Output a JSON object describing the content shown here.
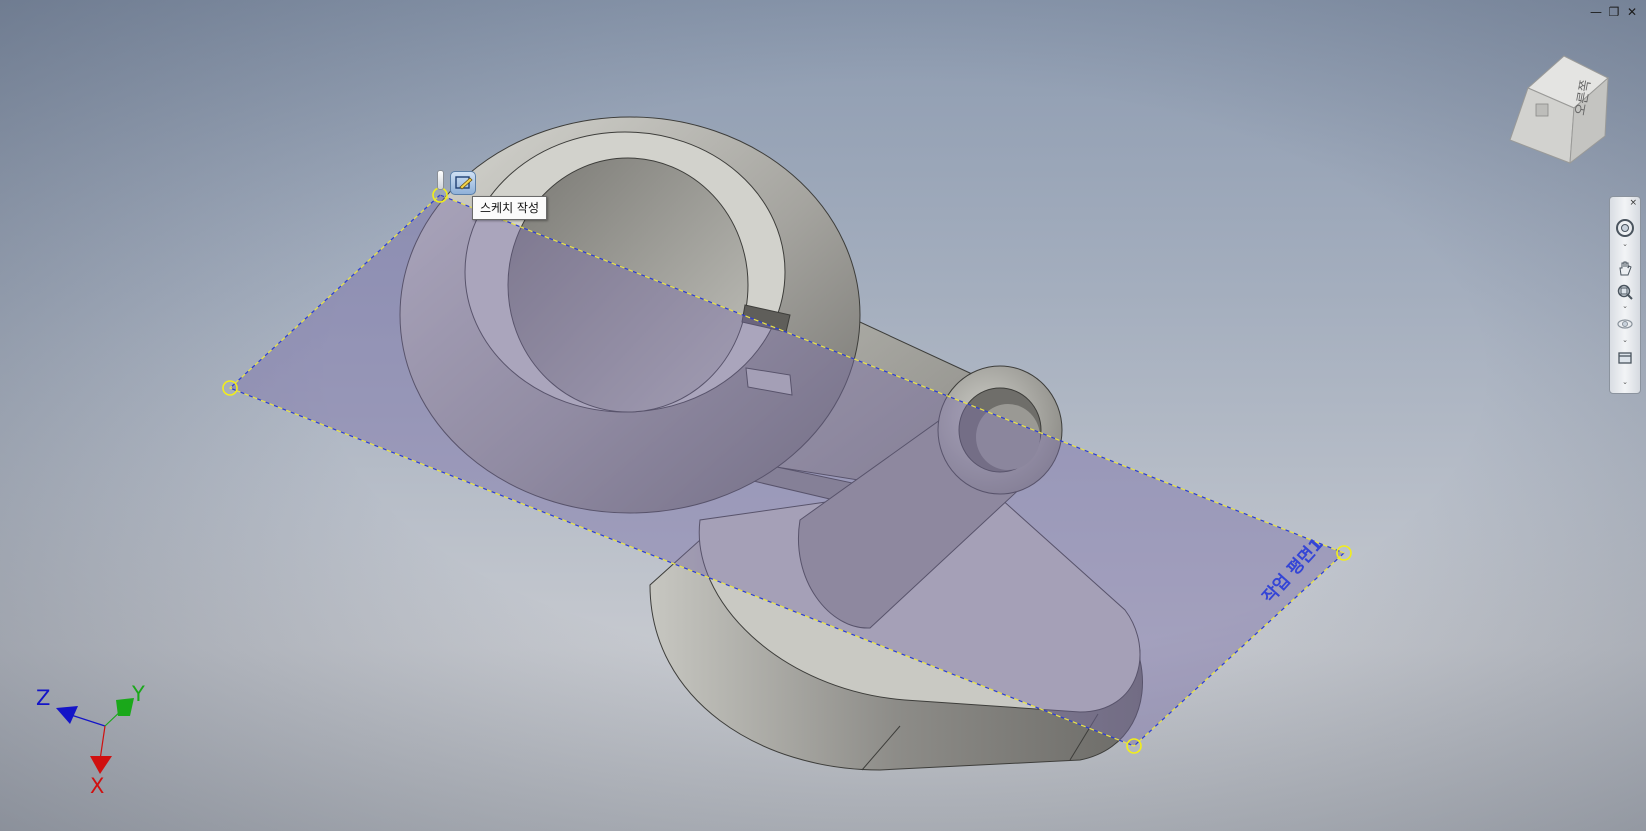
{
  "window_controls": {
    "minimize": "—",
    "restore": "❐",
    "close": "✕"
  },
  "viewcube": {
    "face_label": "오른쪽"
  },
  "tooltip": {
    "text": "스케치 작성"
  },
  "work_plane": {
    "label": "작업 평면1"
  },
  "triad": {
    "x": "X",
    "y": "Y",
    "z": "Z"
  },
  "navbar": {
    "close": "×",
    "tools": [
      "steering-wheel-icon",
      "pan-icon",
      "zoom-icon",
      "orbit-icon",
      "view-face-icon"
    ],
    "expand": "⌄"
  },
  "colors": {
    "plane_fill": "#7a6fa8",
    "plane_edge_blue": "#2c3ecf",
    "plane_edge_yellow": "#e8e24a",
    "grip_yellow": "#f2ee1a",
    "part_light": "#cfcfc9",
    "part_dark": "#7d7c78",
    "axis_x": "#d01010",
    "axis_y": "#1aa81a",
    "axis_z": "#1414c8"
  }
}
